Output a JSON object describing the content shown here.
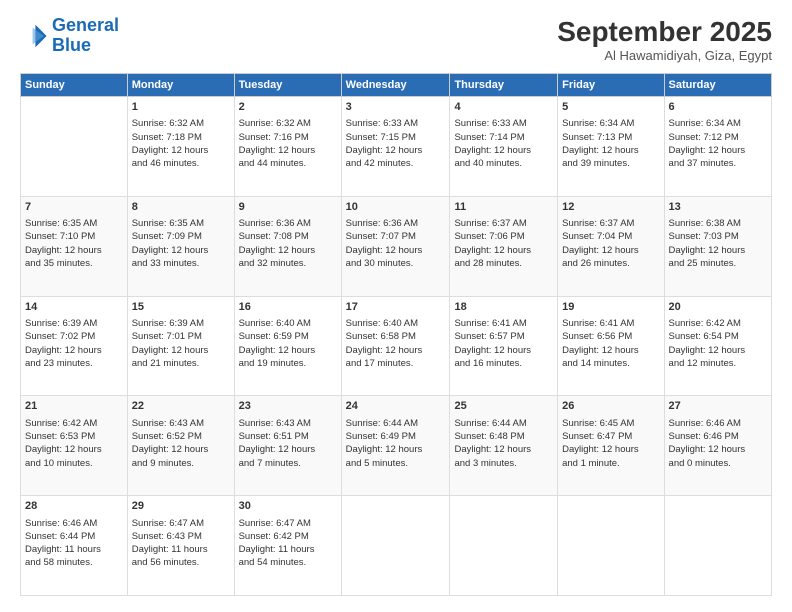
{
  "logo": {
    "line1": "General",
    "line2": "Blue"
  },
  "title": "September 2025",
  "subtitle": "Al Hawamidiyah, Giza, Egypt",
  "weekdays": [
    "Sunday",
    "Monday",
    "Tuesday",
    "Wednesday",
    "Thursday",
    "Friday",
    "Saturday"
  ],
  "weeks": [
    [
      {
        "day": "",
        "lines": []
      },
      {
        "day": "1",
        "lines": [
          "Sunrise: 6:32 AM",
          "Sunset: 7:18 PM",
          "Daylight: 12 hours",
          "and 46 minutes."
        ]
      },
      {
        "day": "2",
        "lines": [
          "Sunrise: 6:32 AM",
          "Sunset: 7:16 PM",
          "Daylight: 12 hours",
          "and 44 minutes."
        ]
      },
      {
        "day": "3",
        "lines": [
          "Sunrise: 6:33 AM",
          "Sunset: 7:15 PM",
          "Daylight: 12 hours",
          "and 42 minutes."
        ]
      },
      {
        "day": "4",
        "lines": [
          "Sunrise: 6:33 AM",
          "Sunset: 7:14 PM",
          "Daylight: 12 hours",
          "and 40 minutes."
        ]
      },
      {
        "day": "5",
        "lines": [
          "Sunrise: 6:34 AM",
          "Sunset: 7:13 PM",
          "Daylight: 12 hours",
          "and 39 minutes."
        ]
      },
      {
        "day": "6",
        "lines": [
          "Sunrise: 6:34 AM",
          "Sunset: 7:12 PM",
          "Daylight: 12 hours",
          "and 37 minutes."
        ]
      }
    ],
    [
      {
        "day": "7",
        "lines": [
          "Sunrise: 6:35 AM",
          "Sunset: 7:10 PM",
          "Daylight: 12 hours",
          "and 35 minutes."
        ]
      },
      {
        "day": "8",
        "lines": [
          "Sunrise: 6:35 AM",
          "Sunset: 7:09 PM",
          "Daylight: 12 hours",
          "and 33 minutes."
        ]
      },
      {
        "day": "9",
        "lines": [
          "Sunrise: 6:36 AM",
          "Sunset: 7:08 PM",
          "Daylight: 12 hours",
          "and 32 minutes."
        ]
      },
      {
        "day": "10",
        "lines": [
          "Sunrise: 6:36 AM",
          "Sunset: 7:07 PM",
          "Daylight: 12 hours",
          "and 30 minutes."
        ]
      },
      {
        "day": "11",
        "lines": [
          "Sunrise: 6:37 AM",
          "Sunset: 7:06 PM",
          "Daylight: 12 hours",
          "and 28 minutes."
        ]
      },
      {
        "day": "12",
        "lines": [
          "Sunrise: 6:37 AM",
          "Sunset: 7:04 PM",
          "Daylight: 12 hours",
          "and 26 minutes."
        ]
      },
      {
        "day": "13",
        "lines": [
          "Sunrise: 6:38 AM",
          "Sunset: 7:03 PM",
          "Daylight: 12 hours",
          "and 25 minutes."
        ]
      }
    ],
    [
      {
        "day": "14",
        "lines": [
          "Sunrise: 6:39 AM",
          "Sunset: 7:02 PM",
          "Daylight: 12 hours",
          "and 23 minutes."
        ]
      },
      {
        "day": "15",
        "lines": [
          "Sunrise: 6:39 AM",
          "Sunset: 7:01 PM",
          "Daylight: 12 hours",
          "and 21 minutes."
        ]
      },
      {
        "day": "16",
        "lines": [
          "Sunrise: 6:40 AM",
          "Sunset: 6:59 PM",
          "Daylight: 12 hours",
          "and 19 minutes."
        ]
      },
      {
        "day": "17",
        "lines": [
          "Sunrise: 6:40 AM",
          "Sunset: 6:58 PM",
          "Daylight: 12 hours",
          "and 17 minutes."
        ]
      },
      {
        "day": "18",
        "lines": [
          "Sunrise: 6:41 AM",
          "Sunset: 6:57 PM",
          "Daylight: 12 hours",
          "and 16 minutes."
        ]
      },
      {
        "day": "19",
        "lines": [
          "Sunrise: 6:41 AM",
          "Sunset: 6:56 PM",
          "Daylight: 12 hours",
          "and 14 minutes."
        ]
      },
      {
        "day": "20",
        "lines": [
          "Sunrise: 6:42 AM",
          "Sunset: 6:54 PM",
          "Daylight: 12 hours",
          "and 12 minutes."
        ]
      }
    ],
    [
      {
        "day": "21",
        "lines": [
          "Sunrise: 6:42 AM",
          "Sunset: 6:53 PM",
          "Daylight: 12 hours",
          "and 10 minutes."
        ]
      },
      {
        "day": "22",
        "lines": [
          "Sunrise: 6:43 AM",
          "Sunset: 6:52 PM",
          "Daylight: 12 hours",
          "and 9 minutes."
        ]
      },
      {
        "day": "23",
        "lines": [
          "Sunrise: 6:43 AM",
          "Sunset: 6:51 PM",
          "Daylight: 12 hours",
          "and 7 minutes."
        ]
      },
      {
        "day": "24",
        "lines": [
          "Sunrise: 6:44 AM",
          "Sunset: 6:49 PM",
          "Daylight: 12 hours",
          "and 5 minutes."
        ]
      },
      {
        "day": "25",
        "lines": [
          "Sunrise: 6:44 AM",
          "Sunset: 6:48 PM",
          "Daylight: 12 hours",
          "and 3 minutes."
        ]
      },
      {
        "day": "26",
        "lines": [
          "Sunrise: 6:45 AM",
          "Sunset: 6:47 PM",
          "Daylight: 12 hours",
          "and 1 minute."
        ]
      },
      {
        "day": "27",
        "lines": [
          "Sunrise: 6:46 AM",
          "Sunset: 6:46 PM",
          "Daylight: 12 hours",
          "and 0 minutes."
        ]
      }
    ],
    [
      {
        "day": "28",
        "lines": [
          "Sunrise: 6:46 AM",
          "Sunset: 6:44 PM",
          "Daylight: 11 hours",
          "and 58 minutes."
        ]
      },
      {
        "day": "29",
        "lines": [
          "Sunrise: 6:47 AM",
          "Sunset: 6:43 PM",
          "Daylight: 11 hours",
          "and 56 minutes."
        ]
      },
      {
        "day": "30",
        "lines": [
          "Sunrise: 6:47 AM",
          "Sunset: 6:42 PM",
          "Daylight: 11 hours",
          "and 54 minutes."
        ]
      },
      {
        "day": "",
        "lines": []
      },
      {
        "day": "",
        "lines": []
      },
      {
        "day": "",
        "lines": []
      },
      {
        "day": "",
        "lines": []
      }
    ]
  ]
}
